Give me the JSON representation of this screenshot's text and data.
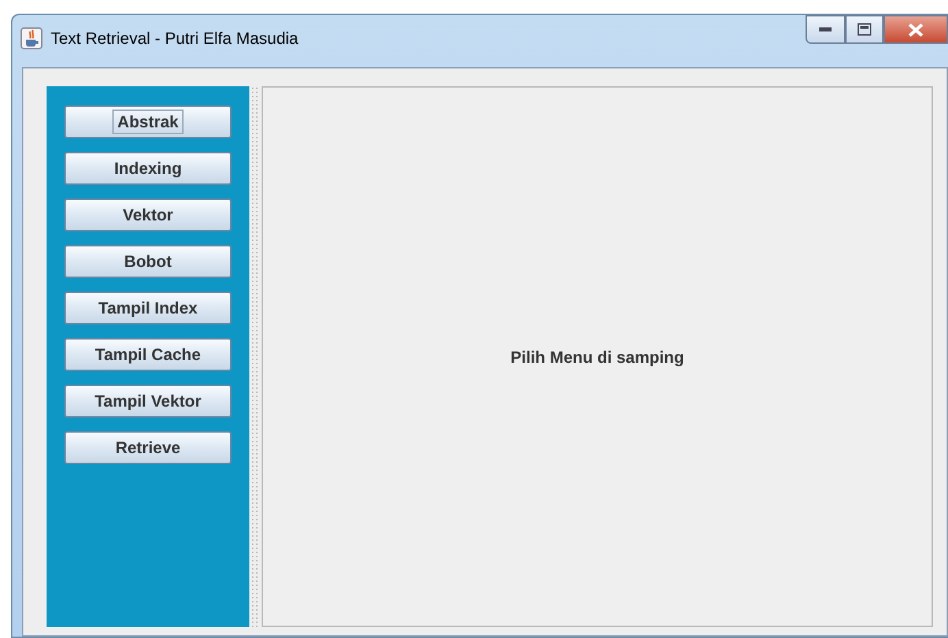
{
  "window": {
    "title": "Text Retrieval - Putri Elfa Masudia"
  },
  "menu_buttons": [
    {
      "label": "Abstrak",
      "focused": true
    },
    {
      "label": "Indexing",
      "focused": false
    },
    {
      "label": "Vektor",
      "focused": false
    },
    {
      "label": "Bobot",
      "focused": false
    },
    {
      "label": "Tampil Index",
      "focused": false
    },
    {
      "label": "Tampil Cache",
      "focused": false
    },
    {
      "label": "Tampil Vektor",
      "focused": false
    },
    {
      "label": "Retrieve",
      "focused": false
    }
  ],
  "content": {
    "message": "Pilih Menu di samping"
  }
}
